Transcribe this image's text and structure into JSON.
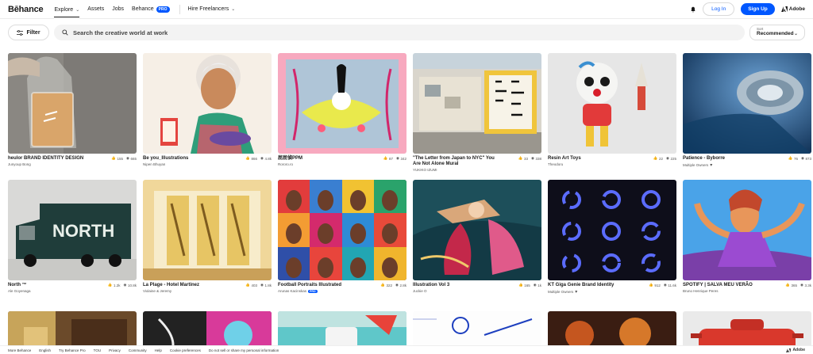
{
  "nav": {
    "logo": "Bēhance",
    "explore": "Explore",
    "assets": "Assets",
    "jobs": "Jobs",
    "behance": "Behance",
    "pro_badge": "PRO",
    "hire": "Hire Freelancers",
    "login": "Log In",
    "signup": "Sign Up",
    "adobe": "Adobe"
  },
  "search": {
    "filter_label": "Filter",
    "placeholder": "Search the creative world at work",
    "sort_label": "Sort",
    "sort_value": "Recommended"
  },
  "projects": [
    {
      "title": "heulor BRAND IDENTITY DESIGN",
      "owner": "Junyoup Bong",
      "likes": "155",
      "views": "665",
      "owner_menu": false,
      "pro": false
    },
    {
      "title": "Be you_Illustrations",
      "owner": "Nipen Bhuyan",
      "likes": "866",
      "views": "4.8k",
      "owner_menu": false,
      "pro": false
    },
    {
      "title": "屁屁偵PPM",
      "owner": "Rororo.ro",
      "likes": "87",
      "views": "342",
      "owner_menu": false,
      "pro": false
    },
    {
      "title": "\"The Letter from Japan to NYC\" You Are Not Alone Mural",
      "owner": "YUKIKO IZUMI",
      "likes": "33",
      "views": "338",
      "owner_menu": false,
      "pro": false
    },
    {
      "title": "Resin Art Toys",
      "owner": "Theodoru",
      "likes": "22",
      "views": "225",
      "owner_menu": false,
      "pro": false
    },
    {
      "title": "Patience - Byborre",
      "owner": "Multiple Owners",
      "likes": "76",
      "views": "873",
      "owner_menu": true,
      "pro": false
    },
    {
      "title": "North ™",
      "owner": "Ale Goyenaga",
      "likes": "1.2k",
      "views": "10.8k",
      "owner_menu": false,
      "pro": false
    },
    {
      "title": "La Plage - Hotel Martinez",
      "owner": "Violaine & Jeremy",
      "likes": "403",
      "views": "1.8k",
      "owner_menu": false,
      "pro": false
    },
    {
      "title": "Football Portraits Illustrated",
      "owner": "Arunas Kacinskas",
      "likes": "322",
      "views": "2.8k",
      "owner_menu": false,
      "pro": true
    },
    {
      "title": "Illustration Vol 3",
      "owner": "Juckie O",
      "likes": "165",
      "views": "1k",
      "owner_menu": false,
      "pro": false
    },
    {
      "title": "KT Giga Genie Brand Identity",
      "owner": "Multiple Owners",
      "likes": "912",
      "views": "11.6k",
      "owner_menu": true,
      "pro": false
    },
    {
      "title": "SPOTIFY | SALVA MEU VERÃO",
      "owner": "Bruno Henrique Peres",
      "likes": "365",
      "views": "3.3k",
      "owner_menu": false,
      "pro": false
    }
  ],
  "truck_text": "NORTH",
  "footer": {
    "more": "More Behance",
    "lang": "English",
    "pro": "Try Behance Pro",
    "tou": "TOU",
    "privacy": "Privacy",
    "community": "Community",
    "help": "Help",
    "cookies": "Cookie preferences",
    "donotsell": "Do not sell or share my personal information",
    "adobe": "Adobe"
  }
}
